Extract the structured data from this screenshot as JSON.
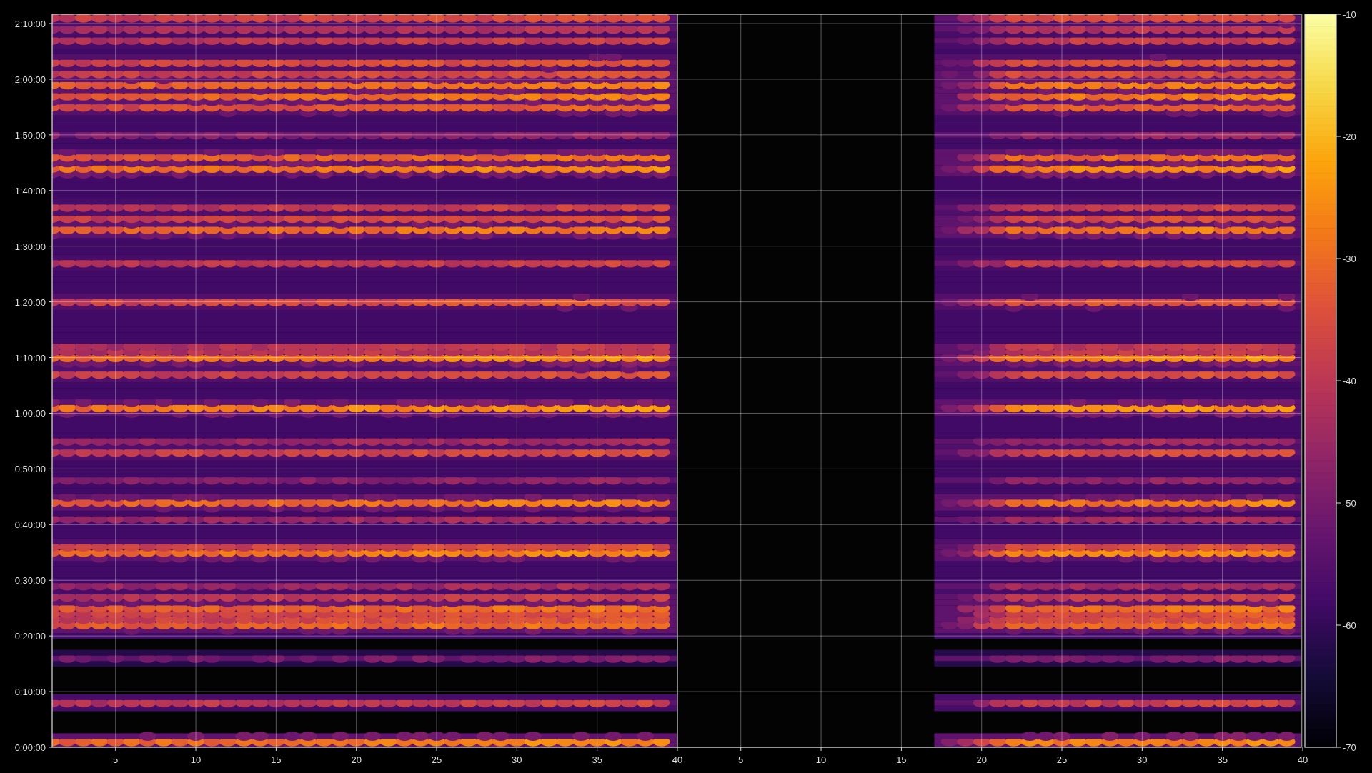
{
  "figure": {
    "yticks": [
      "2:10:00",
      "2:00:00",
      "1:50:00",
      "1:40:00",
      "1:30:00",
      "1:20:00",
      "1:10:00",
      "1:00:00",
      "0:50:00",
      "0:40:00",
      "0:30:00",
      "0:20:00",
      "0:10:00",
      "0:00:00"
    ],
    "panels": [
      {
        "xticks": [
          "5",
          "10",
          "15",
          "20",
          "25",
          "30",
          "35",
          "40"
        ]
      },
      {
        "xticks": [
          "5",
          "10",
          "15",
          "20",
          "25",
          "30",
          "35",
          "40"
        ]
      }
    ],
    "colorbar": {
      "ticks": [
        "-10",
        "-20",
        "-30",
        "-40",
        "-50",
        "-60",
        "-70"
      ]
    }
  }
}
